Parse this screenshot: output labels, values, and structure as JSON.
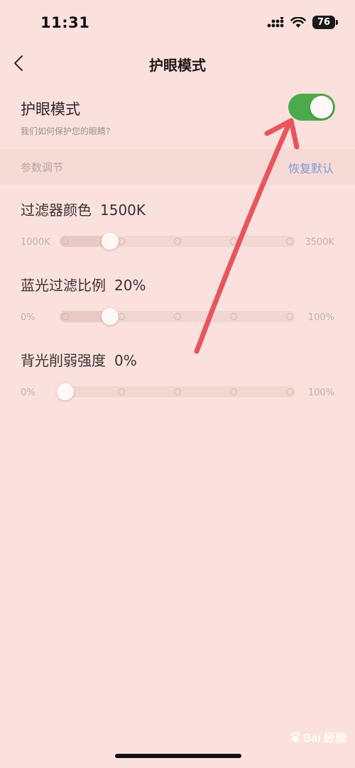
{
  "status": {
    "time": "11:31",
    "battery": "76"
  },
  "nav": {
    "title": "护眼模式"
  },
  "eye_mode": {
    "title": "护眼模式",
    "subtitle": "我们如何保护您的眼睛?",
    "enabled": true
  },
  "section": {
    "title": "参数调节",
    "reset_label": "恢复默认"
  },
  "settings": [
    {
      "label": "过滤器颜色",
      "value": "1500K",
      "min": "1000K",
      "max": "3500K",
      "fraction": 0.2
    },
    {
      "label": "蓝光过滤比例",
      "value": "20%",
      "min": "0%",
      "max": "100%",
      "fraction": 0.2
    },
    {
      "label": "背光削弱强度",
      "value": "0%",
      "min": "0%",
      "max": "100%",
      "fraction": 0.0
    }
  ],
  "watermark": {
    "text": "Bai 经验"
  },
  "colors": {
    "toggle_on": "#4caa4c",
    "link": "#7c9bd4",
    "background": "#fbe1dd",
    "arrow": "#e8555c"
  }
}
